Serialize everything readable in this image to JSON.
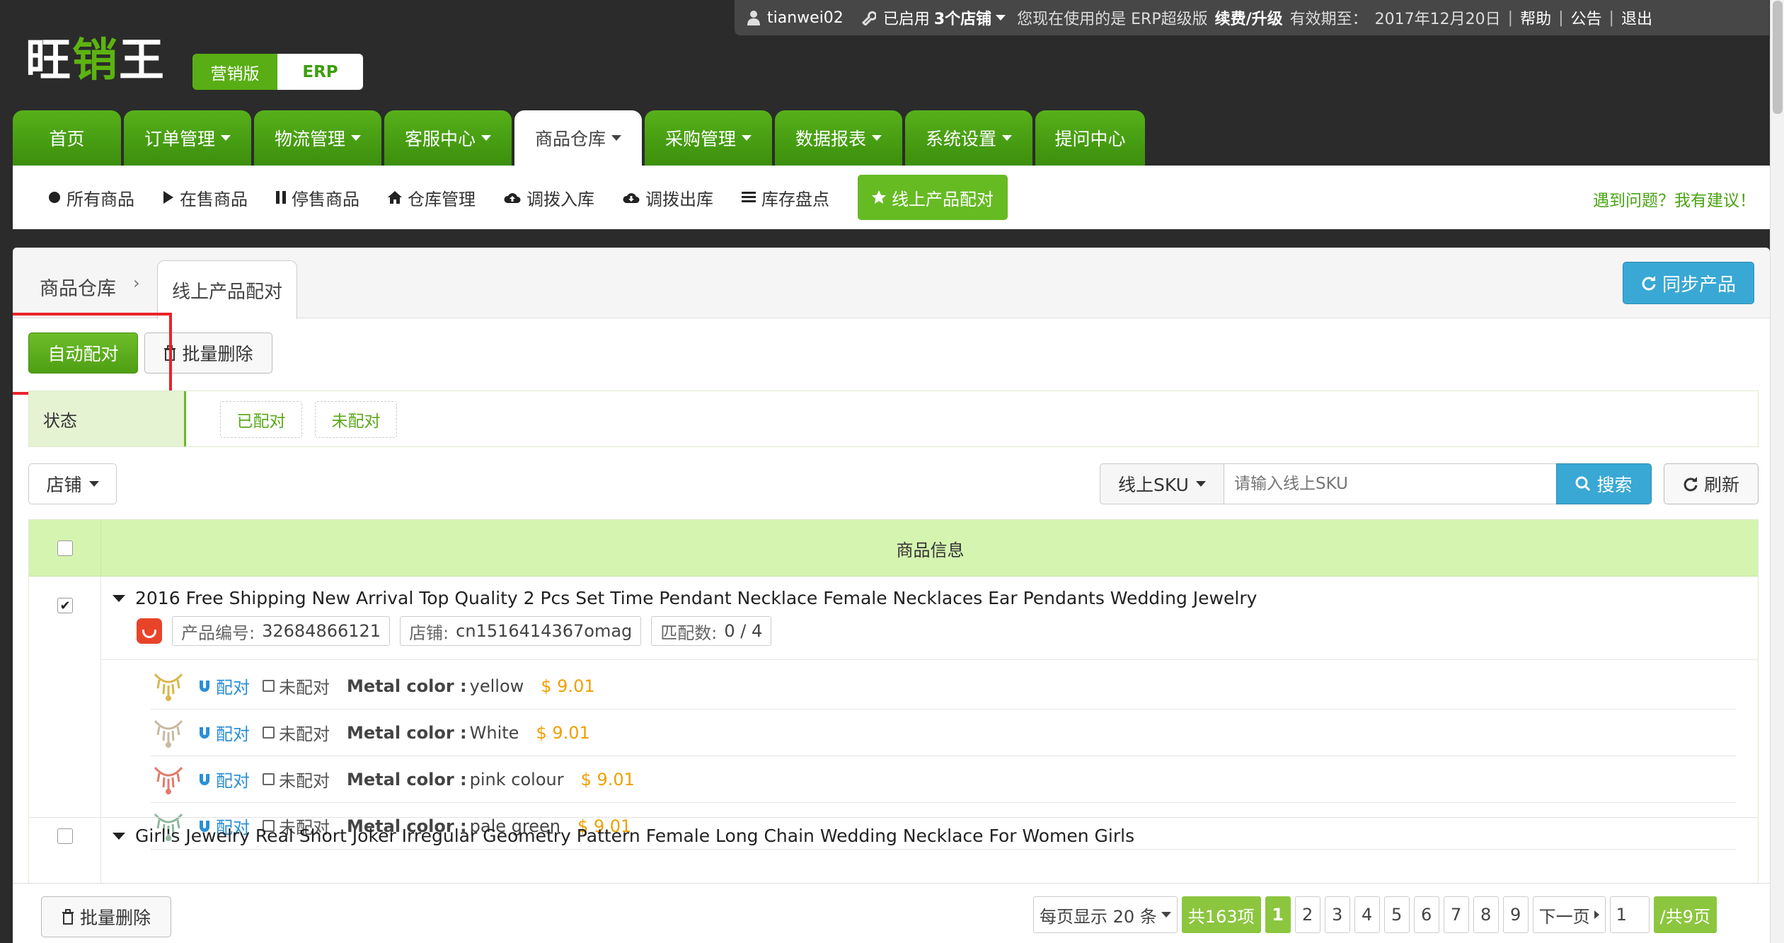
{
  "topbar": {
    "username": "tianwei02",
    "shops_prefix": "已启用",
    "shops_count": "3个店铺",
    "version_text": "您现在使用的是 ERP超级版",
    "renew": "续费/升级",
    "expiry_label": "有效期至：",
    "expiry_date": "2017年12月20日",
    "help": "帮助",
    "notice": "公告",
    "logout": "退出"
  },
  "logo": {
    "part1": "旺",
    "part2": "销",
    "part3": "王"
  },
  "edition": {
    "marketing": "营销版",
    "erp": "ERP"
  },
  "main_nav": [
    {
      "label": "首页",
      "dropdown": false,
      "active": false
    },
    {
      "label": "订单管理",
      "dropdown": true,
      "active": false
    },
    {
      "label": "物流管理",
      "dropdown": true,
      "active": false
    },
    {
      "label": "客服中心",
      "dropdown": true,
      "active": false
    },
    {
      "label": "商品仓库",
      "dropdown": true,
      "active": true
    },
    {
      "label": "采购管理",
      "dropdown": true,
      "active": false
    },
    {
      "label": "数据报表",
      "dropdown": true,
      "active": false
    },
    {
      "label": "系统设置",
      "dropdown": true,
      "active": false
    },
    {
      "label": "提问中心",
      "dropdown": false,
      "active": false
    }
  ],
  "sub_nav": [
    {
      "label": "所有商品",
      "icon": "circle-icon"
    },
    {
      "label": "在售商品",
      "icon": "play-icon"
    },
    {
      "label": "停售商品",
      "icon": "pause-icon"
    },
    {
      "label": "仓库管理",
      "icon": "home-icon"
    },
    {
      "label": "调拨入库",
      "icon": "cloud-upload-icon"
    },
    {
      "label": "调拨出库",
      "icon": "cloud-download-icon"
    },
    {
      "label": "库存盘点",
      "icon": "list-icon"
    },
    {
      "label": "线上产品配对",
      "icon": "star-icon",
      "active": true
    }
  ],
  "feedback": "遇到问题？我有建议！",
  "breadcrumb": {
    "root": "商品仓库",
    "current": "线上产品配对"
  },
  "sync_button": "同步产品",
  "auto_match_button": "自动配对",
  "batch_delete_button": "批量删除",
  "status_filter": {
    "label": "状态",
    "options": [
      "已配对",
      "未配对"
    ]
  },
  "shop_filter": "店铺",
  "search": {
    "field": "线上SKU",
    "placeholder": "请输入线上SKU",
    "button": "搜索"
  },
  "refresh_button": "刷新",
  "table": {
    "header": "商品信息",
    "products": [
      {
        "title": "2016 Free Shipping New Arrival Top Quality 2 Pcs Set Time Pendant Necklace Female Necklaces Ear Pendants Wedding Jewelry",
        "checked": true,
        "product_id_label": "产品编号:",
        "product_id": "32684866121",
        "shop_label": "店铺:",
        "shop": "cn1516414367omag",
        "match_label": "匹配数:",
        "match": "0 / 4",
        "variants": [
          {
            "pair": "配对",
            "status": "未配对",
            "attr": "Metal color :",
            "value": "yellow",
            "price": "$ 9.01",
            "color": "#d9b64a"
          },
          {
            "pair": "配对",
            "status": "未配对",
            "attr": "Metal color :",
            "value": "White",
            "price": "$ 9.01",
            "color": "#c9b9a0"
          },
          {
            "pair": "配对",
            "status": "未配对",
            "attr": "Metal color :",
            "value": "pink colour",
            "price": "$ 9.01",
            "color": "#e07a6a"
          },
          {
            "pair": "配对",
            "status": "未配对",
            "attr": "Metal color :",
            "value": "pale green",
            "price": "$ 9.01",
            "color": "#8fb7a0"
          }
        ]
      },
      {
        "title": "Girl's Jewelry Real Short Joker Irregular Geometry Pattern Female Long Chain Wedding Necklace For Women Girls",
        "checked": false
      }
    ]
  },
  "footer": {
    "batch_delete": "批量删除",
    "per_page": "每页显示 20 条",
    "total": "共163项",
    "pages": [
      "1",
      "2",
      "3",
      "4",
      "5",
      "6",
      "7",
      "8",
      "9"
    ],
    "current_page": "1",
    "next": "下一页",
    "goto_value": "1",
    "total_pages": "/共9页"
  },
  "colors": {
    "accent_green": "#5cb311",
    "link_blue": "#2b8fd6",
    "price_orange": "#f0a000",
    "highlight_red": "#e8232a"
  }
}
